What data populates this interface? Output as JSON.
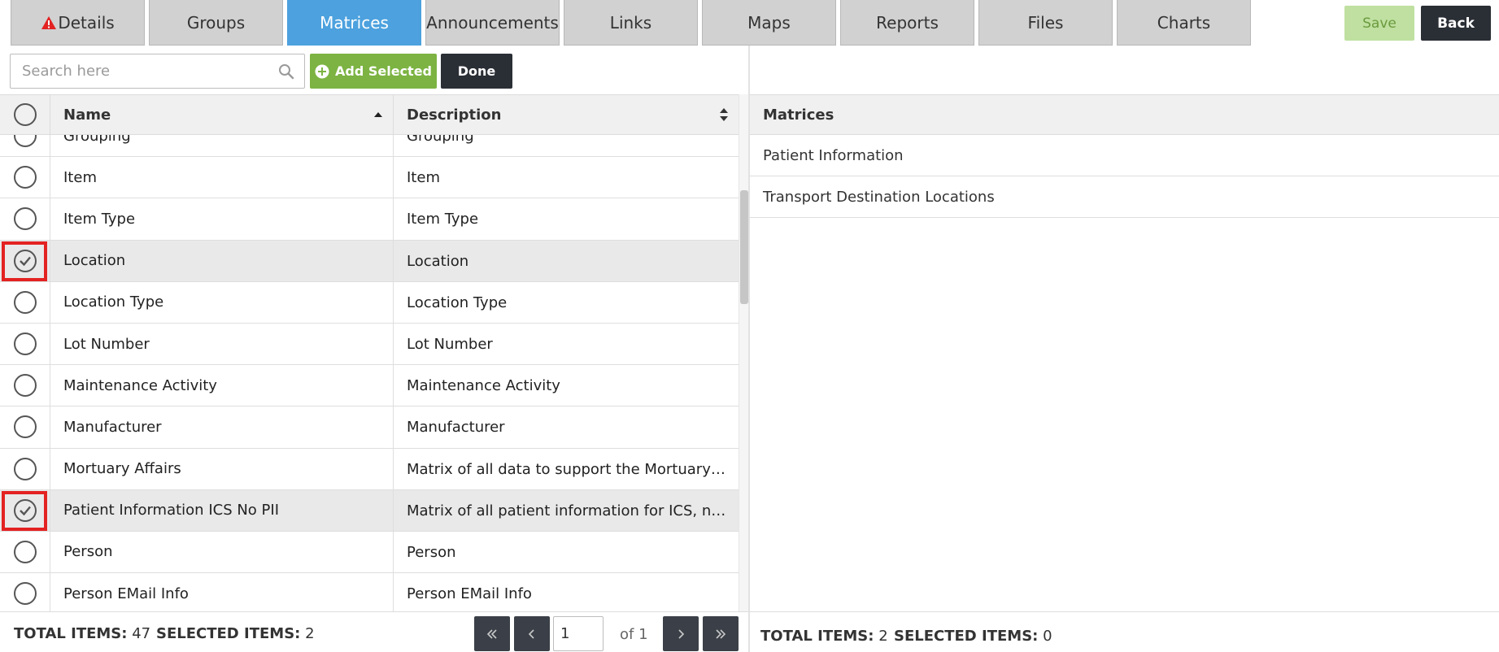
{
  "tabs": [
    {
      "label": "Details",
      "active": false,
      "warning": true
    },
    {
      "label": "Groups",
      "active": false
    },
    {
      "label": "Matrices",
      "active": true
    },
    {
      "label": "Announcements",
      "active": false
    },
    {
      "label": "Links",
      "active": false
    },
    {
      "label": "Maps",
      "active": false
    },
    {
      "label": "Reports",
      "active": false
    },
    {
      "label": "Files",
      "active": false
    },
    {
      "label": "Charts",
      "active": false
    }
  ],
  "header_buttons": {
    "save_label": "Save",
    "back_label": "Back"
  },
  "toolbar": {
    "search_placeholder": "Search here",
    "search_value": "",
    "add_selected_label": "Add Selected",
    "done_label": "Done"
  },
  "left_table": {
    "columns": {
      "name": "Name",
      "description": "Description"
    },
    "rows": [
      {
        "name": "Grouping",
        "description": "Grouping",
        "selected": false
      },
      {
        "name": "Item",
        "description": "Item",
        "selected": false
      },
      {
        "name": "Item Type",
        "description": "Item Type",
        "selected": false
      },
      {
        "name": "Location",
        "description": "Location",
        "selected": true
      },
      {
        "name": "Location Type",
        "description": "Location Type",
        "selected": false
      },
      {
        "name": "Lot Number",
        "description": "Lot Number",
        "selected": false
      },
      {
        "name": "Maintenance Activity",
        "description": "Maintenance Activity",
        "selected": false
      },
      {
        "name": "Manufacturer",
        "description": "Manufacturer",
        "selected": false
      },
      {
        "name": "Mortuary Affairs",
        "description": "Matrix of all data to support the Mortuary Affairs",
        "selected": false
      },
      {
        "name": "Patient Information ICS No PII",
        "description": "Matrix of all patient information for ICS, no PII",
        "selected": true
      },
      {
        "name": "Person",
        "description": "Person",
        "selected": false
      },
      {
        "name": "Person EMail Info",
        "description": "Person EMail Info",
        "selected": false
      }
    ],
    "footer": {
      "total_label": "TOTAL ITEMS:",
      "total_value": "47",
      "selected_label": "SELECTED ITEMS:",
      "selected_value": "2"
    },
    "pagination": {
      "page": "1",
      "of_text": "of 1"
    }
  },
  "right_table": {
    "header": "Matrices",
    "rows": [
      "Patient Information",
      "Transport Destination Locations"
    ],
    "footer": {
      "total_label": "TOTAL ITEMS:",
      "total_value": "2",
      "selected_label": "SELECTED ITEMS:",
      "selected_value": "0"
    }
  },
  "colors": {
    "tab_active": "#4ca1de",
    "tab_inactive": "#d1d1d1",
    "save_button": "#bfe0a0",
    "add_button": "#7cb342",
    "dark_button": "#2a2e35",
    "highlight": "#e32222"
  },
  "icons": {
    "warning": "warning-triangle-icon",
    "search": "search-icon",
    "add": "plus-circle-icon",
    "sort": "sort-icon",
    "check": "check-icon"
  }
}
